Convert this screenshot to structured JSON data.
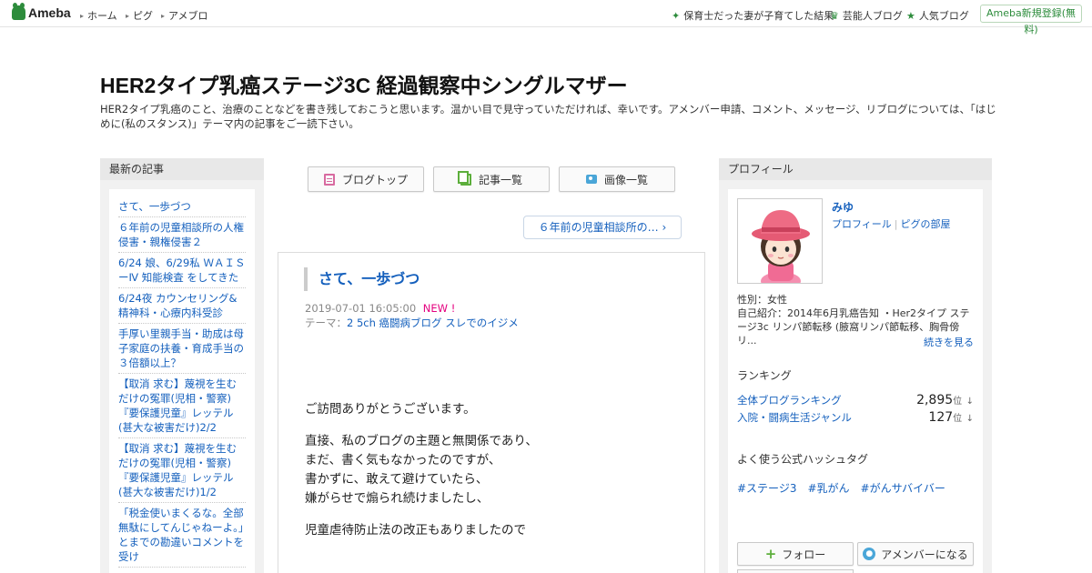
{
  "header": {
    "logo_text": "Ameba",
    "nav": [
      "ホーム",
      "ピグ",
      "アメブロ"
    ],
    "right_links": [
      {
        "icon": "sparkle-icon",
        "label": "保育士だった妻が子育てした結果"
      },
      {
        "icon": "crown-icon",
        "label": "芸能人ブログ"
      },
      {
        "icon": "star-icon",
        "label": "人気ブログ"
      }
    ],
    "signup_label": "Ameba新規登録(無料)"
  },
  "blog": {
    "title": "HER2タイプ乳癌ステージ3C 経過観察中シングルマザー",
    "description": "HER2タイプ乳癌のこと、治療のことなどを書き残しておこうと思います。温かい目で見守っていただければ、幸いです。アメンバー申請、コメント、メッセージ、リブログについては、「はじめに(私のスタンス)」テーマ内の記事をご一読下さい。"
  },
  "recent": {
    "heading": "最新の記事",
    "items": [
      "さて、一歩づつ",
      "６年前の児童相談所の人権侵害・親権侵害２",
      "6/24 娘、6/29私 ＷＡＩＳーⅣ 知能検査 をしてきた",
      "6/24夜 カウンセリング&精神科・心療内科受診",
      "手厚い里親手当・助成は母子家庭の扶養・育成手当の３倍額以上？",
      "【取消 求む】蔑視を生むだけの冤罪(児相・警察)『要保護児童』レッテル(甚大な被害だけ)2/2",
      "【取消 求む】蔑視を生むだけの冤罪(児相・警察)『要保護児童』レッテル(甚大な被害だけ)1/2",
      "「税金使いまくるな。全部無駄にしてんじゃねーよ。」とまでの勘違いコメントを受け"
    ]
  },
  "toolbar": {
    "blog_top": "ブログトップ",
    "entry_list": "記事一覧",
    "image_list": "画像一覧"
  },
  "next_entry_label": "６年前の児童相談所の…",
  "entry": {
    "title": "さて、一歩づつ",
    "datetime": "2019-07-01 16:05:00",
    "new_badge": "NEW !",
    "theme_label": "テーマ：",
    "theme": "2 5ch 癌闘病ブログ スレでのイジメ",
    "paragraphs": [
      "ご訪問ありがとうございます。",
      "直接、私のブログの主題と無関係であり、\nまだ、書く気もなかったのですが、\n書かずに、敢えて避けていたら、\n嫌がらせで煽られ続けましたし、",
      "児童虐待防止法の改正もありましたので"
    ]
  },
  "profile": {
    "heading": "プロフィール",
    "name": "みゆ",
    "link_profile": "プロフィール",
    "link_room": "ピグの部屋",
    "gender": "性別：女性",
    "intro": "自己紹介：2014年6月乳癌告知 ・Her2タイプ ステージ3c リンパ節転移 (腋窩リンパ節転移、胸骨傍リ...",
    "more": "続きを見る",
    "ranking_heading": "ランキング",
    "rankings": [
      {
        "label": "全体ブログランキング",
        "value": "2,895",
        "unit": "位",
        "arrow": "↓"
      },
      {
        "label": "入院・闘病生活ジャンル",
        "value": "127",
        "unit": "位",
        "arrow": "↓"
      }
    ],
    "hashtag_heading": "よく使う公式ハッシュタグ",
    "hashtags": [
      "#ステージ3",
      "#乳がん",
      "#がんサバイバー"
    ],
    "follow_label": "フォロー",
    "member_label": "アメンバーになる"
  },
  "colors": {
    "link": "#1560bd",
    "brand_green": "#2d8c3c",
    "new_badge": "#e4007f"
  }
}
